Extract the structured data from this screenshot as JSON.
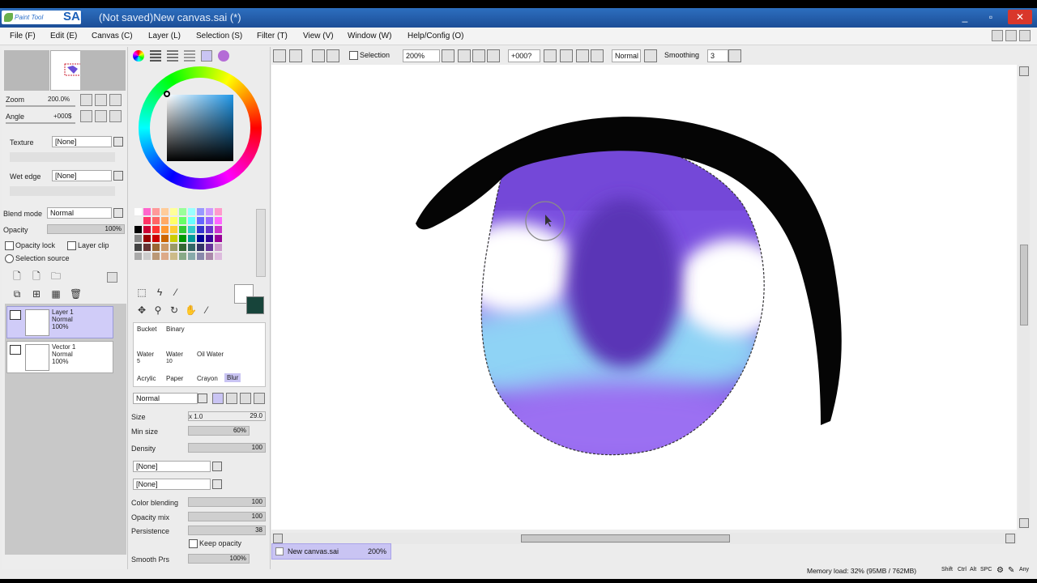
{
  "window": {
    "app_logo_text": "Paint Tool",
    "app_logo_sai": "SAI",
    "title": "(Not saved)New canvas.sai (*)",
    "btn_min": "_",
    "btn_max": "▫",
    "btn_close": "✕"
  },
  "menu": [
    "File (F)",
    "Edit (E)",
    "Canvas (C)",
    "Layer (L)",
    "Selection (S)",
    "Filter (T)",
    "View (V)",
    "Window (W)",
    "Help/Config (O)"
  ],
  "navigator": {
    "zoom_label": "Zoom",
    "zoom_value": "200.0%",
    "angle_label": "Angle",
    "angle_value": "+000$"
  },
  "brush_settings": {
    "texture_label": "Texture",
    "texture_value": "[None]",
    "wet_edge_label": "Wet edge",
    "wet_edge_value": "[None]",
    "blend_mode_label": "Blend mode",
    "blend_mode_value": "Normal",
    "opacity_label": "Opacity",
    "opacity_value": "100%",
    "opacity_lock": "Opacity lock",
    "layer_clip": "Layer clip",
    "selection_source": "Selection source"
  },
  "layers": [
    {
      "name": "Layer 1",
      "mode": "Normal",
      "opacity": "100%",
      "selected": true
    },
    {
      "name": "Vector 1",
      "mode": "Normal",
      "opacity": "100%",
      "selected": false
    }
  ],
  "tools": {
    "grid": [
      [
        "Bucket",
        "Binary"
      ],
      [
        "Water",
        "Water",
        "Oil Water"
      ],
      [
        "Acrylic",
        "Paper",
        "Crayon",
        "Blur"
      ]
    ],
    "water_row_numbers": [
      "5",
      "10"
    ],
    "mode_value": "Normal",
    "size_label": "Size",
    "size_mult": "x 1.0",
    "size_value": "29.0",
    "min_size_label": "Min size",
    "min_size_value": "60%",
    "density_label": "Density",
    "density_value": "100",
    "shape_value": "[None]",
    "texture2_value": "[None]",
    "color_blending_label": "Color blending",
    "color_blending_value": "100",
    "opacity_mix_label": "Opacity mix",
    "opacity_mix_value": "100",
    "persistence_label": "Persistence",
    "persistence_value": "38",
    "keep_opacity_label": "Keep opacity",
    "smooth_prs_label": "Smooth Prs",
    "smooth_prs_value": "100%"
  },
  "canvas_toolbar": {
    "selection_label": "Selection",
    "zoom": "200%",
    "angle": "+000?",
    "blend": "Normal",
    "smoothing_label": "Smoothing",
    "smoothing_value": "3"
  },
  "document_tab": {
    "name": "New canvas.sai",
    "zoom": "200%"
  },
  "status": {
    "memory": "Memory load: 32% (95MB / 762MB)",
    "keys": [
      "Shift",
      "Ctrl",
      "Alt",
      "SPC"
    ],
    "any_label": "Any"
  },
  "colors": {
    "accent": "#c9c4f3",
    "title_bar": "#1f57a8",
    "eye_purple": "#7a4fe0",
    "iris_dark": "#5a36b6",
    "highlight_blue": "#8fd3f5"
  },
  "progress": {
    "size_slider_fraction": 0.29,
    "min_size_fraction": 0.6,
    "density_fraction": 1.0,
    "opacity_mix_fraction": 1.0,
    "persistence_fraction": 0.38,
    "hscroll_fraction": 0.5,
    "vscroll_fraction": 0.4
  }
}
